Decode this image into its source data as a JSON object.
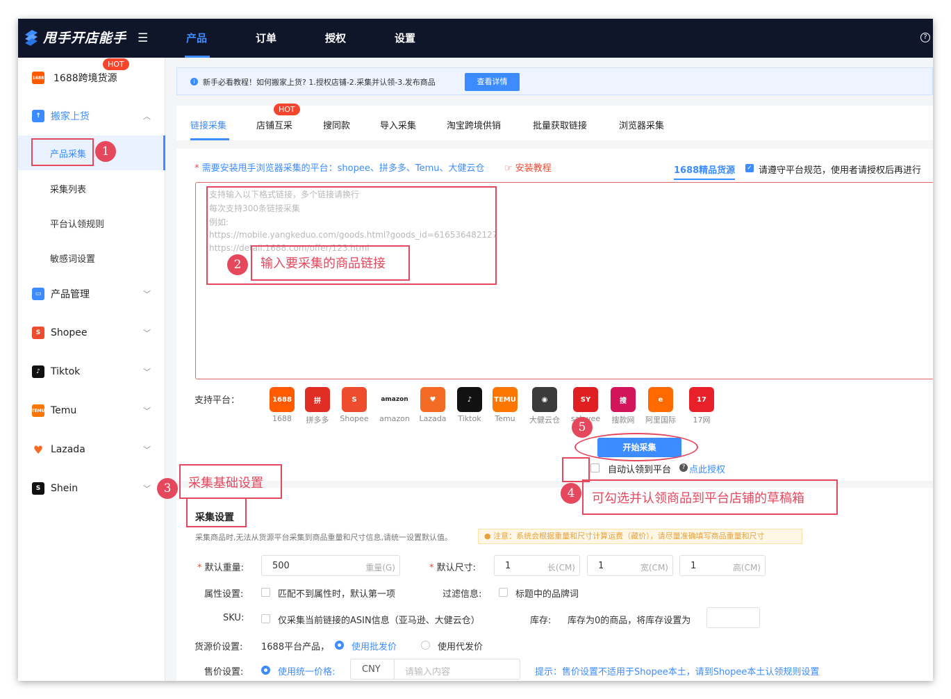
{
  "app": {
    "name": "甩手开店能手",
    "nav": [
      {
        "label": "产品",
        "active": true
      },
      {
        "label": "订单",
        "active": false
      },
      {
        "label": "授权",
        "active": false
      },
      {
        "label": "设置",
        "active": false
      }
    ]
  },
  "sidebar": {
    "hot": "HOT",
    "source_label": "1688跨境货源",
    "source_icon": "1688",
    "group_label": "搬家上货",
    "sub_items": [
      "产品采集",
      "采集列表",
      "平台认领规则",
      "敏感词设置"
    ],
    "items": [
      {
        "label": "产品管理",
        "icon": "box-icon"
      },
      {
        "label": "Shopee",
        "icon": "shopee-icon"
      },
      {
        "label": "Tiktok",
        "icon": "tiktok-icon"
      },
      {
        "label": "Temu",
        "icon": "temu-icon"
      },
      {
        "label": "Lazada",
        "icon": "lazada-icon"
      },
      {
        "label": "Shein",
        "icon": "shein-icon"
      }
    ]
  },
  "notice": {
    "text": "新手必看教程！如何搬家上货? 1.授权店铺-2.采集并认领-3.发布商品",
    "button": "查看详情"
  },
  "tabs": {
    "items": [
      "链接采集",
      "店铺互采",
      "搜同款",
      "导入采集",
      "淘宝跨境供销",
      "批量获取链接",
      "浏览器采集"
    ],
    "hot": "HOT"
  },
  "collect": {
    "requirement": "需要安装甩手浏览器采集的平台：shopee、拼多多、Temu、大健云仓",
    "tutorial": "安装教程",
    "best_source": "1688精品货源",
    "agree": "请遵守平台规范，使用者请授权后再进行",
    "placeholder": [
      "支持输入以下格式链接，多个链接请换行",
      "每次支持300条链接采集",
      "例如:",
      "https://mobile.yangkeduo.com/goods.html?goods_id=616536482127",
      "https://detail.1688.com/offer/123.html"
    ],
    "platform_label": "支持平台：",
    "platforms": [
      {
        "name": "1688",
        "logo": "1688",
        "color": "#ff5a00"
      },
      {
        "name": "拼多多",
        "logo": "拼",
        "color": "#e02e24"
      },
      {
        "name": "Shopee",
        "logo": "S",
        "color": "#ee4d2d"
      },
      {
        "name": "amazon",
        "logo": "amazon",
        "color": "#ffffff"
      },
      {
        "name": "Lazada",
        "logo": "♥",
        "color": "#f36b24"
      },
      {
        "name": "Tiktok",
        "logo": "♪",
        "color": "#111111"
      },
      {
        "name": "Temu",
        "logo": "TEMU",
        "color": "#fb7701"
      },
      {
        "name": "大健云仓",
        "logo": "◉",
        "color": "#3b3b3b"
      },
      {
        "name": "saleyee",
        "logo": "SY",
        "color": "#e02020"
      },
      {
        "name": "搜款网",
        "logo": "搜",
        "color": "#d4145a"
      },
      {
        "name": "阿里国际",
        "logo": "e",
        "color": "#ff6a00"
      },
      {
        "name": "17网",
        "logo": "17",
        "color": "#e8202a"
      }
    ],
    "start_button": "开始采集",
    "auto_claim": "自动认领到平台",
    "auth_link": "点此授权"
  },
  "settings": {
    "title": "采集设置",
    "desc": "采集商品时,无法从货源平台采集到商品重量和尺寸信息,请统一设置默认值。",
    "warn": "注意：系统会根据重量和尺寸计算运费（藏价），请尽量准确填写商品重量和尺寸",
    "weight_label": "默认重量:",
    "weight_value": "500",
    "weight_unit": "重量(G)",
    "size_label": "默认尺寸:",
    "length_value": "1",
    "length_unit": "长(CM)",
    "width_value": "1",
    "width_unit": "宽(CM)",
    "height_value": "1",
    "height_unit": "高(CM)",
    "attr_label": "属性设置:",
    "attr_option": "匹配不到属性时，默认第一项",
    "filter_label": "过滤信息:",
    "filter_option": "标题中的品牌词",
    "sku_label": "SKU:",
    "sku_option": "仅采集当前链接的ASIN信息（亚马逊、大健云仓）",
    "stock_label": "库存:",
    "stock_text": "库存为0的商品，将库存设置为",
    "src_price_label": "货源价设置:",
    "src_price_text": "1688平台产品，",
    "wholesale": "使用批发价",
    "dropship": "使用代发价",
    "sell_price_label": "售价设置:",
    "uniform": "使用统一价格:",
    "currency": "CNY",
    "price_placeholder": "请输入内容",
    "tip": "提示：售价设置不适用于Shopee本土，请到Shopee本土认领规则设置"
  },
  "annotations": {
    "n1": "1",
    "n2": "2",
    "n3": "3",
    "n4": "4",
    "n5": "5",
    "t2": "输入要采集的商品链接",
    "t3": "采集基础设置",
    "t4": "可勾选并认领商品到平台店铺的草稿箱"
  }
}
